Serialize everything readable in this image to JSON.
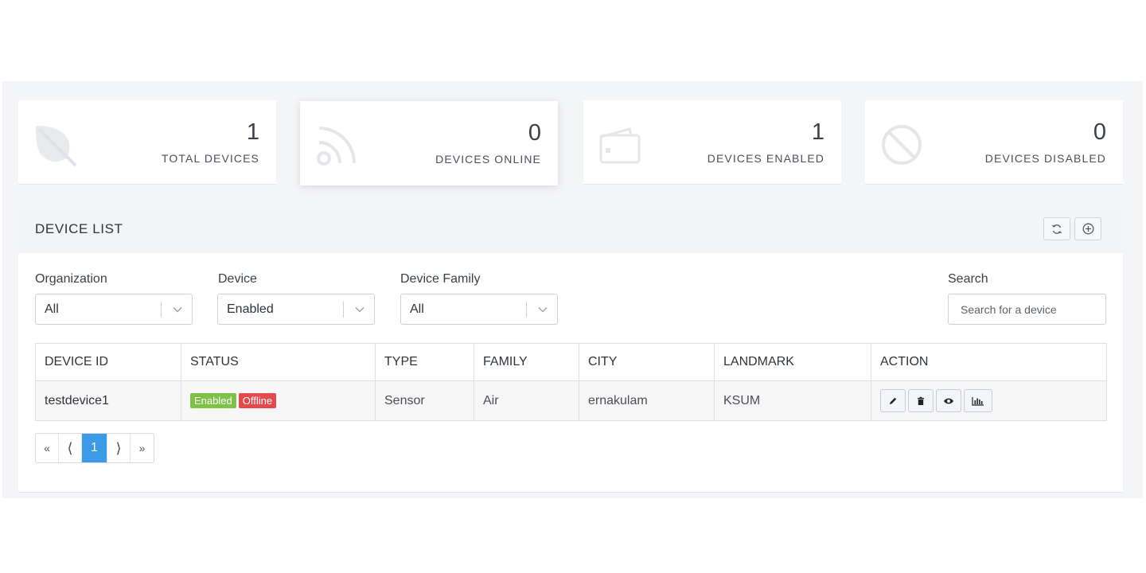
{
  "stats": [
    {
      "value": "1",
      "label": "TOTAL DEVICES",
      "icon": "leaf-icon"
    },
    {
      "value": "0",
      "label": "DEVICES ONLINE",
      "icon": "rss-icon"
    },
    {
      "value": "1",
      "label": "DEVICES ENABLED",
      "icon": "wallet-icon"
    },
    {
      "value": "0",
      "label": "DEVICES DISABLED",
      "icon": "ban-icon"
    }
  ],
  "device_list": {
    "title": "DEVICE LIST",
    "header_buttons": [
      "refresh-icon",
      "add-circle-icon"
    ],
    "filters": {
      "organization": {
        "label": "Organization",
        "value": "All"
      },
      "device": {
        "label": "Device",
        "value": "Enabled"
      },
      "family": {
        "label": "Device Family",
        "value": "All"
      },
      "search": {
        "label": "Search",
        "placeholder": "Search for a device"
      }
    },
    "columns": [
      "DEVICE ID",
      "STATUS",
      "TYPE",
      "FAMILY",
      "CITY",
      "LANDMARK",
      "ACTION"
    ],
    "rows": [
      {
        "device_id": "testdevice1",
        "status": [
          "Enabled",
          "Offline"
        ],
        "type": "Sensor",
        "family": "Air",
        "city": "ernakulam",
        "landmark": "KSUM",
        "actions": [
          "pencil-icon",
          "trash-icon",
          "eye-icon",
          "bar-chart-icon"
        ]
      }
    ],
    "pagination": {
      "first": "«",
      "prev": "⟨",
      "current": "1",
      "next": "⟩",
      "last": "»"
    }
  },
  "colors": {
    "enabled_badge": "#7dc247",
    "offline_badge": "#e5484d",
    "active_page": "#3b9be6",
    "icon_muted": "#e3e5ea"
  }
}
